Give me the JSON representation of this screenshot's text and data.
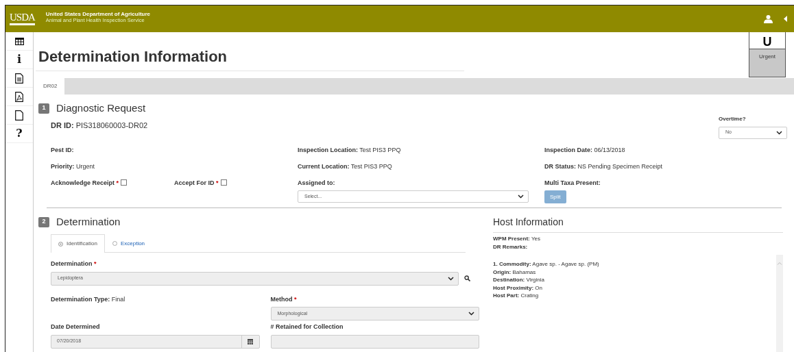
{
  "header": {
    "logo": "USDA",
    "agency": "United States Department of Agriculture",
    "service": "Animal and Plant Health Inspection Service"
  },
  "sidebar": [
    {
      "kind": "grid"
    },
    {
      "kind": "glyph",
      "text": "i"
    },
    {
      "kind": "document"
    },
    {
      "kind": "pdf"
    },
    {
      "kind": "page"
    },
    {
      "kind": "glyph",
      "text": "?"
    }
  ],
  "title": "Determination Information",
  "priority_badge": {
    "letter": "U",
    "label": "Urgent"
  },
  "tabs": [
    {
      "label": "DR02",
      "selected": true
    }
  ],
  "diagnostic": {
    "number": "1",
    "title": "Diagnostic Request",
    "dr_id": {
      "label": "DR ID:",
      "value": "PIS318060003-DR02"
    },
    "overtime": {
      "label": "Overtime?",
      "value": "No"
    },
    "info": [
      {
        "label": "Pest ID:"
      },
      {
        "label": "Inspection Location:",
        "value": "Test PIS3 PPQ"
      },
      {
        "label": "Inspection Date:",
        "value": "06/13/2018"
      },
      {
        "label": "Priority:",
        "value": "Urgent"
      },
      {
        "label": "Current Location:",
        "value": "Test PIS3 PPQ"
      },
      {
        "label": "DR Status:",
        "value": "NS Pending Specimen Receipt"
      }
    ],
    "checks": [
      {
        "label": "Acknowledge Receipt",
        "required_mark": "*",
        "checked": false
      },
      {
        "label": "Accept For ID",
        "required_mark": "*",
        "checked": false
      }
    ],
    "assigned": {
      "label": "Assigned to:",
      "value": "Select..."
    },
    "multi_taxa": {
      "label": "Multi Taxa Present:",
      "button": "Split",
      "disabled": true
    }
  },
  "determination": {
    "number": "2",
    "title": "Determination",
    "tabs": [
      {
        "label": "Identification",
        "selected": true
      },
      {
        "label": "Exception",
        "selected": false
      }
    ],
    "determination": {
      "label": "Determination",
      "required_mark": "*",
      "value": "Lepidoptera"
    },
    "type": {
      "label": "Determination Type:",
      "value": "Final"
    },
    "method": {
      "label": "Method",
      "required_mark": "*",
      "value": "Morphological"
    },
    "date": {
      "label": "Date Determined",
      "value": "07/20/2018"
    },
    "retained": {
      "label": "# Retained for Collection"
    }
  },
  "host": {
    "title": "Host Information",
    "summary": [
      {
        "label": "WPM Present:",
        "value": "Yes"
      },
      {
        "label": "DR Remarks:"
      }
    ],
    "details": [
      {
        "label": "1. Commodity:",
        "value": "Agave sp. - Agave sp. (PM)"
      },
      {
        "label": "Origin:",
        "value": "Bahamas"
      },
      {
        "label": "Destination:",
        "value": "Virginia"
      },
      {
        "label": "Host Proximity:",
        "value": "On"
      },
      {
        "label": "Host Part:",
        "value": "Crating"
      }
    ]
  }
}
